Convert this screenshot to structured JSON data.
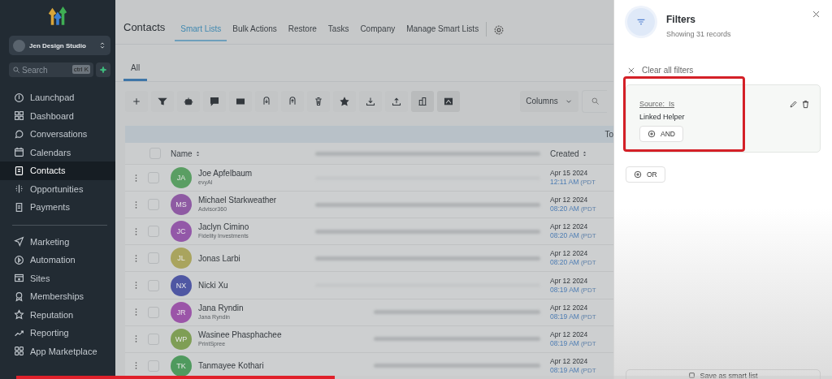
{
  "sidebar": {
    "workspace": "Jen Design Studio",
    "search": {
      "placeholder": "Search",
      "shortcut": "ctrl K"
    },
    "nav": [
      {
        "label": "Launchpad",
        "selected": false
      },
      {
        "label": "Dashboard",
        "selected": false
      },
      {
        "label": "Conversations",
        "selected": false
      },
      {
        "label": "Calendars",
        "selected": false
      },
      {
        "label": "Contacts",
        "selected": true
      },
      {
        "label": "Opportunities",
        "selected": false
      },
      {
        "label": "Payments",
        "selected": false
      }
    ],
    "nav_secondary": [
      {
        "label": "Marketing",
        "selected": false
      },
      {
        "label": "Automation",
        "selected": false
      },
      {
        "label": "Sites",
        "selected": false
      },
      {
        "label": "Memberships",
        "selected": false
      },
      {
        "label": "Reputation",
        "selected": false
      },
      {
        "label": "Reporting",
        "selected": false
      },
      {
        "label": "App Marketplace",
        "selected": false
      }
    ]
  },
  "header": {
    "title": "Contacts",
    "tabs": [
      {
        "label": "Smart Lists",
        "selected": true
      },
      {
        "label": "Bulk Actions",
        "selected": false
      },
      {
        "label": "Restore",
        "selected": false
      },
      {
        "label": "Tasks",
        "selected": false
      },
      {
        "label": "Company",
        "selected": false
      },
      {
        "label": "Manage Smart Lists",
        "selected": false
      }
    ]
  },
  "views": [
    {
      "label": "All",
      "selected": true
    }
  ],
  "toolbar": {
    "columns_button": "Columns"
  },
  "table": {
    "band_text": "To",
    "columns": [
      "Name",
      "Created"
    ],
    "select_all_checked": false,
    "rows": [
      {
        "initials": "JA",
        "name": "Joe Apfelbaum",
        "company": "evyAI",
        "color": "#5a9e63",
        "date": "Apr 15 2024",
        "time": "12:11 AM",
        "zone": "(PDT",
        "checked": false
      },
      {
        "initials": "MS",
        "name": "Michael Starkweather",
        "company": "Advisor360",
        "color": "#8e5aa3",
        "date": "Apr 12 2024",
        "time": "08:20 AM",
        "zone": "(PDT",
        "checked": false
      },
      {
        "initials": "JC",
        "name": "Jaclyn Cimino",
        "company": "Fidelity Investments",
        "color": "#9358a8",
        "date": "Apr 12 2024",
        "time": "08:20 AM",
        "zone": "(PDT",
        "checked": false
      },
      {
        "initials": "JL",
        "name": "Jonas Larbi",
        "company": "",
        "color": "#a9a45e",
        "date": "Apr 12 2024",
        "time": "08:20 AM",
        "zone": "(PDT",
        "checked": false
      },
      {
        "initials": "NX",
        "name": "Nicki Xu",
        "company": "",
        "color": "#4f57a3",
        "date": "Apr 12 2024",
        "time": "08:19 AM",
        "zone": "(PDT",
        "checked": false
      },
      {
        "initials": "JR",
        "name": "Jana Ryndin",
        "company": "Jana Ryndin",
        "color": "#9b55a8",
        "date": "Apr 12 2024",
        "time": "08:19 AM",
        "zone": "(PDT",
        "checked": false
      },
      {
        "initials": "WP",
        "name": "Wasinee Phasphachee",
        "company": "PrintSpree",
        "color": "#7f9e55",
        "date": "Apr 12 2024",
        "time": "08:19 AM",
        "zone": "(PDT",
        "checked": false
      },
      {
        "initials": "TK",
        "name": "Tanmayee Kothari",
        "company": "",
        "color": "#4f9a5e",
        "date": "Apr 12 2024",
        "time": "08:19 AM",
        "zone": "(PDT",
        "checked": false
      }
    ]
  },
  "filters": {
    "title": "Filters",
    "subtitle": "Showing 31 records",
    "clear": "Clear all filters",
    "groups": [
      {
        "field": "Source:  Is",
        "value": "Linked Helper",
        "and_button": "AND",
        "highlighted": true
      }
    ],
    "or_button": "OR",
    "save_button": "Save as smart list"
  },
  "video_progress": {
    "level": 0.39
  }
}
